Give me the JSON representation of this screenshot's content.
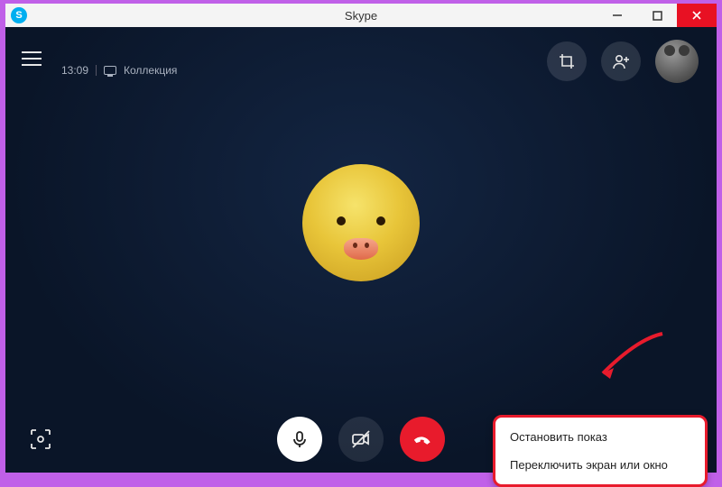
{
  "titlebar": {
    "app_initial": "S",
    "title": "Skype"
  },
  "topbar": {
    "time": "13:09",
    "collection_label": "Коллекция"
  },
  "menu": {
    "stop_label": "Остановить показ",
    "switch_label": "Переключить экран или окно"
  },
  "colors": {
    "hangup": "#e81b2c",
    "accent": "#00aff0",
    "heart": "#e81b2c"
  }
}
